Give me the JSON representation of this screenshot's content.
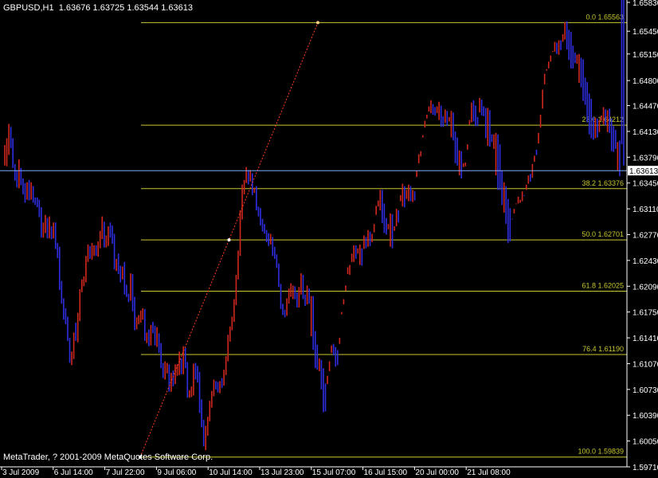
{
  "header": {
    "symbol": "GBPUSD,H1",
    "open": "1.63676",
    "high": "1.63725",
    "low": "1.63544",
    "close": "1.63613"
  },
  "copyright": "MetaTrader, ? 2001-2009 MetaQuotes Software Corp.",
  "colors": {
    "background": "#000000",
    "grid_text": "#ffffff",
    "bull_bar": "#d0281e",
    "bear_bar": "#2e2ee0",
    "fib_level": "#c8c830",
    "trend_line": "#ff3c1e",
    "current_price_line": "#7fa8ff"
  },
  "chart_data": {
    "type": "bar",
    "title": "GBPUSD,H1",
    "ylim": [
      1.5971,
      1.6583
    ],
    "y_ticks": [
      "1.65830",
      "1.65450",
      "1.65150",
      "1.64800",
      "1.64470",
      "1.64130",
      "1.63790",
      "1.63450",
      "1.63110",
      "1.62770",
      "1.62430",
      "1.62090",
      "1.61750",
      "1.61410",
      "1.61070",
      "1.60730",
      "1.60390",
      "1.60050",
      "1.59710"
    ],
    "x_ticks": [
      "3 Jul 2009",
      "6 Jul 14:00",
      "7 Jul 22:00",
      "9 Jul 06:00",
      "10 Jul 14:00",
      "13 Jul 23:00",
      "15 Jul 07:00",
      "16 Jul 15:00",
      "20 Jul 00:00",
      "21 Jul 08:00"
    ],
    "current_price": 1.63613,
    "current_price_label": "1.63613",
    "fib_levels": [
      {
        "label": "0.0  1.65563",
        "value": 1.65563
      },
      {
        "label": "23.6  1.64212",
        "value": 1.64212
      },
      {
        "label": "38.2  1.63376",
        "value": 1.63376
      },
      {
        "label": "50.0  1.62701",
        "value": 1.62701
      },
      {
        "label": "61.8  1.62025",
        "value": 1.62025
      },
      {
        "label": "76.4  1.61190",
        "value": 1.6119
      },
      {
        "label": "100.0  1.59839",
        "value": 1.59839
      }
    ],
    "series": [
      {
        "name": "GBPUSD,H1",
        "close": [
          1.6373,
          1.6388,
          1.6413,
          1.6396,
          1.637,
          1.6353,
          1.6345,
          1.6356,
          1.6347,
          1.6333,
          1.6324,
          1.634,
          1.6326,
          1.6338,
          1.6324,
          1.6319,
          1.6316,
          1.6304,
          1.6278,
          1.6284,
          1.6294,
          1.6275,
          1.6284,
          1.6275,
          1.6285,
          1.6263,
          1.6256,
          1.6207,
          1.6189,
          1.6172,
          1.6167,
          1.6141,
          1.6111,
          1.6116,
          1.6144,
          1.6142,
          1.6166,
          1.6203,
          1.6215,
          1.6216,
          1.6244,
          1.6261,
          1.6248,
          1.6256,
          1.6256,
          1.6251,
          1.6262,
          1.6272,
          1.6291,
          1.6263,
          1.6264,
          1.6279,
          1.6278,
          1.6272,
          1.6234,
          1.6239,
          1.6227,
          1.622,
          1.6231,
          1.6202,
          1.6197,
          1.6193,
          1.6218,
          1.6178,
          1.6154,
          1.6163,
          1.6164,
          1.6168,
          1.6177,
          1.6138,
          1.6145,
          1.6135,
          1.6155,
          1.6153,
          1.6134,
          1.6145,
          1.6124,
          1.6104,
          1.6092,
          1.6097,
          1.6103,
          1.6073,
          1.6088,
          1.6082,
          1.6095,
          1.6097,
          1.6115,
          1.6096,
          1.6122,
          1.6103,
          1.6064,
          1.6068,
          1.6068,
          1.61,
          1.6092,
          1.6088,
          1.6047,
          1.6028,
          1.6,
          1.6015,
          1.6035,
          1.6052,
          1.6066,
          1.608,
          1.6075,
          1.6072,
          1.6081,
          1.608,
          1.6097,
          1.6113,
          1.6139,
          1.6154,
          1.6167,
          1.6188,
          1.6222,
          1.6252,
          1.6304,
          1.6336,
          1.6347,
          1.6353,
          1.6352,
          1.6355,
          1.6332,
          1.6335,
          1.6312,
          1.6308,
          1.6294,
          1.6283,
          1.6282,
          1.6272,
          1.6266,
          1.6273,
          1.6255,
          1.6249,
          1.6236,
          1.6211,
          1.6183,
          1.6177,
          1.6173,
          1.6189,
          1.6197,
          1.6203,
          1.6204,
          1.6198,
          1.6184,
          1.6202,
          1.6223,
          1.6195,
          1.6187,
          1.6201,
          1.6193,
          1.6194,
          1.6146,
          1.6129,
          1.6103,
          1.6106,
          1.61,
          1.6076,
          1.6049,
          1.6085,
          1.6103,
          1.6129,
          1.6125,
          1.6123,
          1.6108,
          1.6137,
          1.6174,
          1.6187,
          1.6206,
          1.6229,
          1.6229,
          1.6246,
          1.626,
          1.6247,
          1.6253,
          1.6256,
          1.6241,
          1.6268,
          1.6263,
          1.6278,
          1.6268,
          1.6274,
          1.6282,
          1.6306,
          1.6318,
          1.6331,
          1.6313,
          1.6295,
          1.6281,
          1.6287,
          1.6301,
          1.6265,
          1.6286,
          1.6306,
          1.6297,
          1.6324,
          1.6336,
          1.6319,
          1.6329,
          1.634,
          1.6323,
          1.6331,
          1.6325,
          1.6357,
          1.6374,
          1.6383,
          1.6406,
          1.6421,
          1.6432,
          1.6441,
          1.6447,
          1.6441,
          1.6438,
          1.6441,
          1.6446,
          1.6431,
          1.6424,
          1.6437,
          1.6426,
          1.6427,
          1.6436,
          1.641,
          1.6403,
          1.6373,
          1.6384,
          1.6357,
          1.6368,
          1.637,
          1.6393,
          1.6425,
          1.6447,
          1.6445,
          1.6428,
          1.6423,
          1.6451,
          1.6443,
          1.6438,
          1.6437,
          1.6441,
          1.6407,
          1.6398,
          1.6402,
          1.6407,
          1.6393,
          1.6358,
          1.6341,
          1.6341,
          1.632,
          1.6311,
          1.6294,
          1.6271,
          1.6301,
          1.6313,
          1.6321,
          1.6321,
          1.6325,
          1.6324,
          1.6331,
          1.6349,
          1.6347,
          1.6349,
          1.638,
          1.6375,
          1.6394,
          1.6415,
          1.6439,
          1.6472,
          1.6492,
          1.6496,
          1.6498,
          1.6516,
          1.6528,
          1.6522,
          1.653,
          1.6518,
          1.6526,
          1.6555,
          1.6546,
          1.654,
          1.6524,
          1.6512,
          1.6499,
          1.6509,
          1.6509,
          1.6506,
          1.6481,
          1.6474,
          1.6456,
          1.6454,
          1.6429,
          1.6414,
          1.6428,
          1.6405,
          1.6409,
          1.6429,
          1.6439,
          1.6431,
          1.6439,
          1.6425,
          1.6417,
          1.6414,
          1.6391,
          1.6397,
          1.6394,
          1.6366,
          1.6361
        ],
        "high": [
          1.6395,
          1.6404,
          1.6423,
          1.6419,
          1.6404,
          1.637,
          1.6362,
          1.6376,
          1.6365,
          1.6351,
          1.6345,
          1.6346,
          1.6349,
          1.6346,
          1.6341,
          1.6326,
          1.6326,
          1.6323,
          1.6313,
          1.6293,
          1.6303,
          1.6299,
          1.6301,
          1.6288,
          1.6293,
          1.6293,
          1.6266,
          1.6261,
          1.6216,
          1.6193,
          1.618,
          1.6169,
          1.6141,
          1.6123,
          1.6148,
          1.6161,
          1.6174,
          1.6205,
          1.6218,
          1.6222,
          1.6249,
          1.6264,
          1.6262,
          1.6266,
          1.6263,
          1.6263,
          1.6268,
          1.6282,
          1.6301,
          1.6294,
          1.6276,
          1.6288,
          1.6293,
          1.6289,
          1.6278,
          1.6245,
          1.6252,
          1.6236,
          1.6235,
          1.6241,
          1.6211,
          1.6199,
          1.6226,
          1.6225,
          1.6195,
          1.6168,
          1.6171,
          1.6177,
          1.618,
          1.6179,
          1.6148,
          1.6152,
          1.6158,
          1.6162,
          1.6157,
          1.6155,
          1.6147,
          1.6134,
          1.6108,
          1.611,
          1.6108,
          1.6106,
          1.6095,
          1.6098,
          1.6106,
          1.6106,
          1.6123,
          1.6114,
          1.613,
          1.6128,
          1.6109,
          1.6072,
          1.6077,
          1.6107,
          1.6108,
          1.6104,
          1.6096,
          1.606,
          1.6033,
          1.6025,
          1.6037,
          1.6058,
          1.6071,
          1.6086,
          1.6084,
          1.6083,
          1.6084,
          1.6088,
          1.6099,
          1.6117,
          1.6145,
          1.6156,
          1.6169,
          1.6192,
          1.6224,
          1.6256,
          1.6309,
          1.6343,
          1.6349,
          1.6366,
          1.6362,
          1.6362,
          1.6358,
          1.6339,
          1.6341,
          1.6314,
          1.6312,
          1.6298,
          1.6291,
          1.6283,
          1.6279,
          1.6278,
          1.6274,
          1.6261,
          1.6251,
          1.6239,
          1.6212,
          1.6186,
          1.6178,
          1.6193,
          1.6206,
          1.6213,
          1.621,
          1.6209,
          1.6201,
          1.6208,
          1.6226,
          1.6224,
          1.6198,
          1.621,
          1.6206,
          1.6196,
          1.6196,
          1.615,
          1.6132,
          1.6114,
          1.6112,
          1.6101,
          1.6081,
          1.6091,
          1.611,
          1.6131,
          1.6133,
          1.6129,
          1.6125,
          1.6141,
          1.6175,
          1.6192,
          1.621,
          1.6234,
          1.6237,
          1.6252,
          1.6263,
          1.6263,
          1.6259,
          1.6264,
          1.6259,
          1.6276,
          1.6274,
          1.6283,
          1.6281,
          1.6278,
          1.6291,
          1.6315,
          1.6322,
          1.6336,
          1.6336,
          1.6318,
          1.6299,
          1.6291,
          1.6305,
          1.6304,
          1.6288,
          1.6311,
          1.6309,
          1.6329,
          1.6344,
          1.6341,
          1.6336,
          1.6343,
          1.6341,
          1.6336,
          1.6334,
          1.6361,
          1.6383,
          1.6387,
          1.6408,
          1.6427,
          1.6435,
          1.6446,
          1.6454,
          1.6449,
          1.6445,
          1.6446,
          1.6452,
          1.6447,
          1.6433,
          1.6442,
          1.644,
          1.6432,
          1.644,
          1.6438,
          1.6413,
          1.6405,
          1.6388,
          1.6387,
          1.6371,
          1.6372,
          1.6396,
          1.6428,
          1.6451,
          1.6454,
          1.6447,
          1.6432,
          1.6457,
          1.6455,
          1.6446,
          1.6444,
          1.6444,
          1.6441,
          1.6409,
          1.6409,
          1.6411,
          1.6409,
          1.6396,
          1.6361,
          1.6346,
          1.6341,
          1.6324,
          1.6312,
          1.6297,
          1.6305,
          1.6318,
          1.6327,
          1.6323,
          1.6334,
          1.6329,
          1.6336,
          1.6355,
          1.6357,
          1.6352,
          1.6381,
          1.6382,
          1.6397,
          1.6418,
          1.6443,
          1.6475,
          1.6495,
          1.6505,
          1.6505,
          1.6519,
          1.6531,
          1.653,
          1.6533,
          1.6533,
          1.6531,
          1.6557,
          1.6558,
          1.6547,
          1.6544,
          1.6526,
          1.6517,
          1.6514,
          1.6515,
          1.651,
          1.6508,
          1.6484,
          1.6478,
          1.6463,
          1.6456,
          1.6432,
          1.6431,
          1.643,
          1.6412,
          1.6434,
          1.6445,
          1.6442,
          1.6441,
          1.6443,
          1.643,
          1.642,
          1.6415,
          1.6399,
          1.6401,
          1.6396,
          1.6368
        ],
        "low": [
          1.6368,
          1.6367,
          1.6382,
          1.6391,
          1.6365,
          1.6348,
          1.6339,
          1.6338,
          1.6342,
          1.633,
          1.6319,
          1.6323,
          1.6322,
          1.6323,
          1.6319,
          1.6316,
          1.6313,
          1.63,
          1.6273,
          1.6273,
          1.6279,
          1.6272,
          1.6272,
          1.6271,
          1.6272,
          1.6258,
          1.6246,
          1.6204,
          1.6186,
          1.6165,
          1.6159,
          1.6137,
          1.6108,
          1.6105,
          1.6113,
          1.6137,
          1.6135,
          1.6163,
          1.6201,
          1.6209,
          1.6214,
          1.6241,
          1.6245,
          1.6244,
          1.6249,
          1.6249,
          1.6248,
          1.6259,
          1.6271,
          1.626,
          1.626,
          1.6262,
          1.6273,
          1.6265,
          1.6231,
          1.6229,
          1.6225,
          1.6214,
          1.6218,
          1.6198,
          1.6195,
          1.6188,
          1.619,
          1.6176,
          1.6151,
          1.6152,
          1.6159,
          1.6161,
          1.6165,
          1.6137,
          1.6134,
          1.613,
          1.6131,
          1.6147,
          1.6131,
          1.6129,
          1.6121,
          1.6101,
          1.6088,
          1.6086,
          1.6094,
          1.607,
          1.607,
          1.6077,
          1.608,
          1.6091,
          1.6092,
          1.6093,
          1.6093,
          1.6101,
          1.6062,
          1.6062,
          1.6063,
          1.6065,
          1.6086,
          1.6082,
          1.6042,
          1.6023,
          1.5998,
          1.5993,
          1.6012,
          1.6031,
          1.6049,
          1.6064,
          1.6073,
          1.6069,
          1.6068,
          1.6075,
          1.6078,
          1.6092,
          1.611,
          1.6136,
          1.6151,
          1.6162,
          1.6184,
          1.6218,
          1.6249,
          1.6297,
          1.633,
          1.6345,
          1.6343,
          1.6347,
          1.6329,
          1.6332,
          1.6309,
          1.6301,
          1.6289,
          1.6281,
          1.6278,
          1.6267,
          1.6262,
          1.6264,
          1.6249,
          1.6245,
          1.6233,
          1.6208,
          1.6179,
          1.6171,
          1.6168,
          1.617,
          1.6186,
          1.6195,
          1.6192,
          1.6192,
          1.6181,
          1.6181,
          1.6198,
          1.6192,
          1.6183,
          1.6185,
          1.6186,
          1.6143,
          1.6125,
          1.6101,
          1.6099,
          1.6097,
          1.6073,
          1.6043,
          1.6044,
          1.608,
          1.6097,
          1.6121,
          1.6118,
          1.6103,
          1.6105,
          1.6133,
          1.6172,
          1.6185,
          1.6203,
          1.6225,
          1.6224,
          1.6241,
          1.6241,
          1.6245,
          1.6252,
          1.6237,
          1.6236,
          1.6258,
          1.6259,
          1.6261,
          1.6262,
          1.6267,
          1.628,
          1.6303,
          1.6314,
          1.6309,
          1.6292,
          1.6279,
          1.6277,
          1.6284,
          1.6261,
          1.6259,
          1.6282,
          1.6288,
          1.6293,
          1.6321,
          1.6314,
          1.6313,
          1.6324,
          1.6321,
          1.6321,
          1.632,
          1.6322,
          1.6353,
          1.6371,
          1.638,
          1.6405,
          1.6418,
          1.643,
          1.6439,
          1.6437,
          1.6435,
          1.6434,
          1.6437,
          1.6428,
          1.6419,
          1.6419,
          1.6424,
          1.642,
          1.6426,
          1.6405,
          1.6401,
          1.6371,
          1.6368,
          1.6355,
          1.6351,
          1.6366,
          1.6367,
          1.6389,
          1.6422,
          1.6425,
          1.6426,
          1.642,
          1.642,
          1.6438,
          1.6434,
          1.6433,
          1.6404,
          1.6394,
          1.6393,
          1.6399,
          1.639,
          1.6355,
          1.6336,
          1.6336,
          1.6316,
          1.6306,
          1.6291,
          1.6266,
          1.6268,
          1.6298,
          1.6311,
          1.6317,
          1.6318,
          1.6319,
          1.6321,
          1.6328,
          1.6343,
          1.6344,
          1.6347,
          1.637,
          1.6373,
          1.6389,
          1.6411,
          1.6435,
          1.6468,
          1.6489,
          1.6493,
          1.6496,
          1.6513,
          1.6518,
          1.6518,
          1.6515,
          1.6514,
          1.652,
          1.6541,
          1.6534,
          1.6521,
          1.6507,
          1.6496,
          1.6496,
          1.6503,
          1.6502,
          1.6477,
          1.6471,
          1.6453,
          1.6448,
          1.6425,
          1.6409,
          1.6404,
          1.6402,
          1.6404,
          1.6405,
          1.6428,
          1.6427,
          1.6422,
          1.6421,
          1.6412,
          1.6411,
          1.6387,
          1.6386,
          1.639,
          1.6361,
          1.6354
        ]
      }
    ],
    "trend_line": {
      "from": {
        "x": "7 Jul 22:00",
        "y": 1.59839
      },
      "to": {
        "x": "15 Jul 07:00",
        "y": 1.65563
      }
    }
  }
}
